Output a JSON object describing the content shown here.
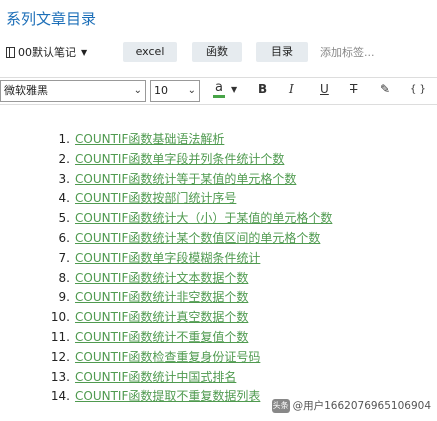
{
  "page_title": "系列文章目录",
  "toolbar": {
    "notebook": "00默认笔记",
    "tags": [
      "excel",
      "函数",
      "目录"
    ],
    "add_tag_placeholder": "添加标签..."
  },
  "format": {
    "font_name": "微软雅黑",
    "font_size": "10",
    "color_letter": "a",
    "bold": "B",
    "italic": "I",
    "underline": "U",
    "strike": "ㄈ",
    "brush": "✎",
    "code": "{ }",
    "color_hex": "#47a447"
  },
  "articles": [
    {
      "num": "1.",
      "title": "COUNTIF函数基础语法解析"
    },
    {
      "num": "2.",
      "title": "COUNTIF函数单字段并列条件统计个数"
    },
    {
      "num": "3.",
      "title": "COUNTIF函数统计等于某值的单元格个数"
    },
    {
      "num": "4.",
      "title": "COUNTIF函数按部门统计序号"
    },
    {
      "num": "5.",
      "title": "COUNTIF函数统计大（小）于某值的单元格个数"
    },
    {
      "num": "6.",
      "title": "COUNTIF函数统计某个数值区间的单元格个数"
    },
    {
      "num": "7.",
      "title": "COUNTIF函数单字段模糊条件统计"
    },
    {
      "num": "8.",
      "title": "COUNTIF函数统计文本数据个数"
    },
    {
      "num": "9.",
      "title": "COUNTIF函数统计非空数据个数"
    },
    {
      "num": "10.",
      "title": "COUNTIF函数统计真空数据个数"
    },
    {
      "num": "11.",
      "title": "COUNTIF函数统计不重复值个数"
    },
    {
      "num": "12.",
      "title": "COUNTIF函数检查重复身份证号码"
    },
    {
      "num": "13.",
      "title": "COUNTIF函数统计中国式排名"
    },
    {
      "num": "14.",
      "title": "COUNTIF函数提取不重复数据列表"
    }
  ],
  "watermark": {
    "logo": "头条",
    "text": "@用户1662076965106904"
  }
}
